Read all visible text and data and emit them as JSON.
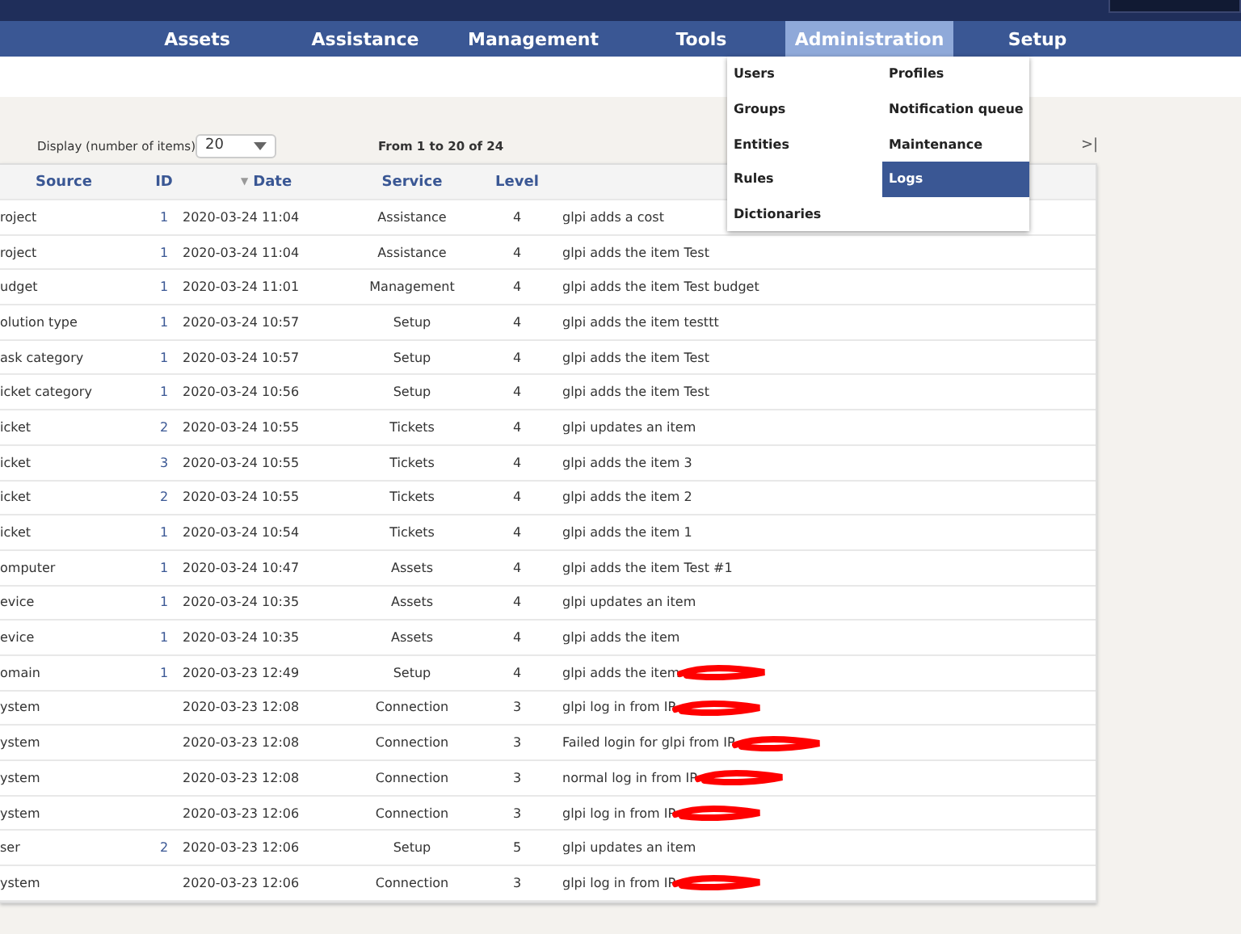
{
  "nav": {
    "items": [
      {
        "label": "Assets",
        "selected": false
      },
      {
        "label": "Assistance",
        "selected": false
      },
      {
        "label": "Management",
        "selected": false
      },
      {
        "label": "Tools",
        "selected": false
      },
      {
        "label": "Administration",
        "selected": true
      },
      {
        "label": "Setup",
        "selected": false
      }
    ]
  },
  "menu": {
    "columns": [
      [
        {
          "label": "Users",
          "selected": false
        },
        {
          "label": "Groups",
          "selected": false
        },
        {
          "label": "Entities",
          "selected": false
        },
        {
          "label": "Rules",
          "selected": false
        },
        {
          "label": "Dictionaries",
          "selected": false
        }
      ],
      [
        {
          "label": "Profiles",
          "selected": false
        },
        {
          "label": "Notification queue",
          "selected": false
        },
        {
          "label": "Maintenance",
          "selected": false
        },
        {
          "label": "Logs",
          "selected": true
        }
      ]
    ]
  },
  "pager": {
    "display_label": "Display (number of items)",
    "page_size": "20",
    "range": "From 1 to 20 of 24",
    "last": ">|"
  },
  "table": {
    "columns": [
      "Source",
      "ID",
      "Date",
      "Service",
      "Level"
    ],
    "sort_mark": "▼",
    "rows": [
      {
        "source": "roject",
        "id": "1",
        "date": "2020-03-24 11:04",
        "service": "Assistance",
        "level": "4",
        "message": "glpi adds a cost",
        "redacted": false
      },
      {
        "source": "roject",
        "id": "1",
        "date": "2020-03-24 11:04",
        "service": "Assistance",
        "level": "4",
        "message": "glpi adds the item Test",
        "redacted": false
      },
      {
        "source": "udget",
        "id": "1",
        "date": "2020-03-24 11:01",
        "service": "Management",
        "level": "4",
        "message": "glpi adds the item Test budget",
        "redacted": false
      },
      {
        "source": "olution type",
        "id": "1",
        "date": "2020-03-24 10:57",
        "service": "Setup",
        "level": "4",
        "message": "glpi adds the item testtt",
        "redacted": false
      },
      {
        "source": "ask category",
        "id": "1",
        "date": "2020-03-24 10:57",
        "service": "Setup",
        "level": "4",
        "message": "glpi adds the item Test",
        "redacted": false
      },
      {
        "source": "icket category",
        "id": "1",
        "date": "2020-03-24 10:56",
        "service": "Setup",
        "level": "4",
        "message": "glpi adds the item Test",
        "redacted": false
      },
      {
        "source": "icket",
        "id": "2",
        "date": "2020-03-24 10:55",
        "service": "Tickets",
        "level": "4",
        "message": "glpi updates an item",
        "redacted": false
      },
      {
        "source": "icket",
        "id": "3",
        "date": "2020-03-24 10:55",
        "service": "Tickets",
        "level": "4",
        "message": "glpi adds the item 3",
        "redacted": false
      },
      {
        "source": "icket",
        "id": "2",
        "date": "2020-03-24 10:55",
        "service": "Tickets",
        "level": "4",
        "message": "glpi adds the item 2",
        "redacted": false
      },
      {
        "source": "icket",
        "id": "1",
        "date": "2020-03-24 10:54",
        "service": "Tickets",
        "level": "4",
        "message": "glpi adds the item 1",
        "redacted": false
      },
      {
        "source": "omputer",
        "id": "1",
        "date": "2020-03-24 10:47",
        "service": "Assets",
        "level": "4",
        "message": "glpi adds the item Test #1",
        "redacted": false
      },
      {
        "source": "evice",
        "id": "1",
        "date": "2020-03-24 10:35",
        "service": "Assets",
        "level": "4",
        "message": "glpi updates an item",
        "redacted": false
      },
      {
        "source": "evice",
        "id": "1",
        "date": "2020-03-24 10:35",
        "service": "Assets",
        "level": "4",
        "message": "glpi adds the item",
        "redacted": false
      },
      {
        "source": "omain",
        "id": "1",
        "date": "2020-03-23 12:49",
        "service": "Setup",
        "level": "4",
        "message": "glpi adds the item",
        "redacted": true
      },
      {
        "source": "ystem",
        "date": "2020-03-23 12:08",
        "service": "Connection",
        "level": "3",
        "message": "glpi log in from IP",
        "redacted": true
      },
      {
        "source": "ystem",
        "date": "2020-03-23 12:08",
        "service": "Connection",
        "level": "3",
        "message": "Failed login for glpi from IP",
        "redacted": true
      },
      {
        "source": "ystem",
        "date": "2020-03-23 12:08",
        "service": "Connection",
        "level": "3",
        "message": "normal log in from IP",
        "redacted": true
      },
      {
        "source": "ystem",
        "date": "2020-03-23 12:06",
        "service": "Connection",
        "level": "3",
        "message": "glpi log in from IP",
        "redacted": true
      },
      {
        "source": "ser",
        "id": "2",
        "date": "2020-03-23 12:06",
        "service": "Setup",
        "level": "5",
        "message": "glpi updates an item",
        "redacted": false
      },
      {
        "source": "ystem",
        "date": "2020-03-23 12:06",
        "service": "Connection",
        "level": "3",
        "message": "glpi log in from IP",
        "redacted": true
      }
    ]
  }
}
